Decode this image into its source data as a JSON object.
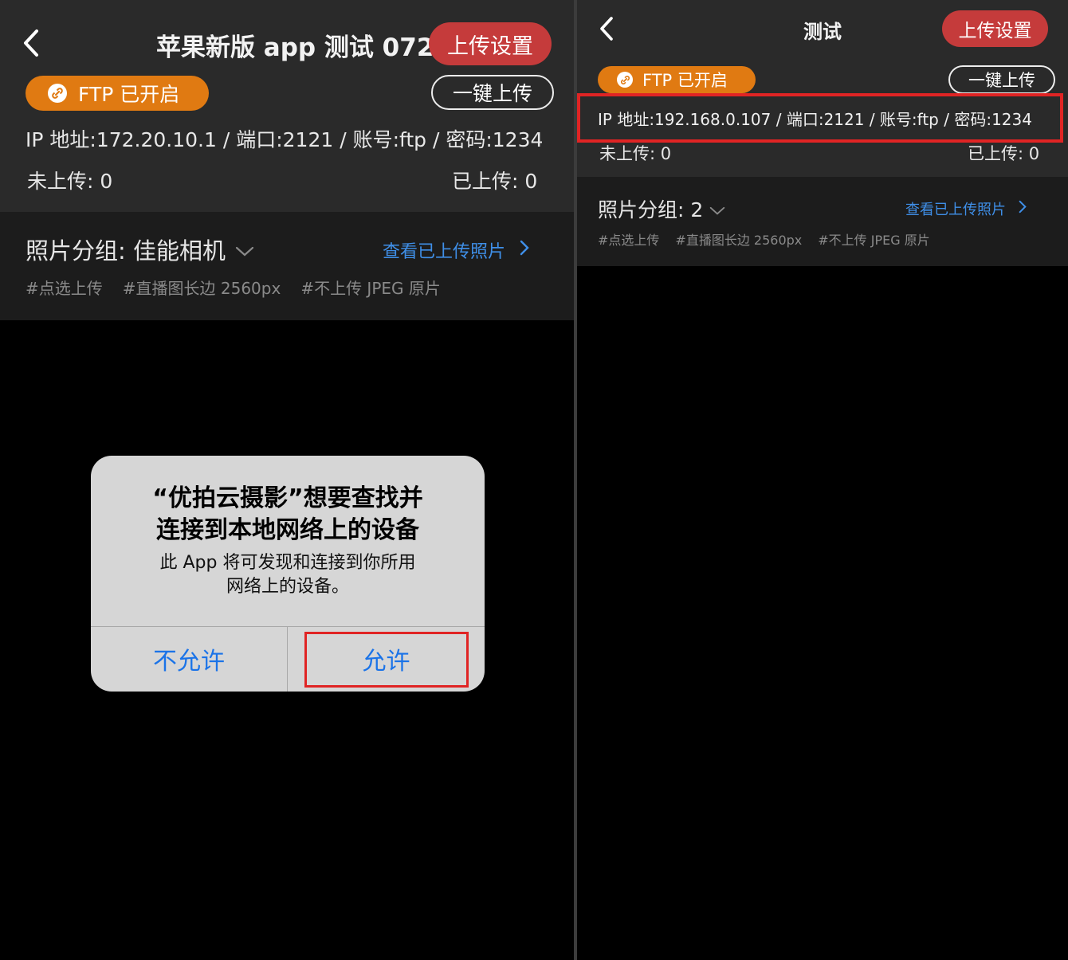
{
  "left_screen": {
    "title": "苹果新版 app 测试 0727",
    "upload_settings_label": "上传设置",
    "ftp_badge_label": "FTP 已开启",
    "one_click_upload_label": "一键上传",
    "connection_info": "IP 地址:172.20.10.1 / 端口:2121 / 账号:ftp / 密码:1234",
    "not_uploaded": "未上传:  0",
    "uploaded": "已上传:  0",
    "photo_group_label": "照片分组:  佳能相机",
    "view_uploaded_label": "查看已上传照片",
    "tags": [
      "#点选上传",
      "#直播图长边 2560px",
      "#不上传 JPEG 原片"
    ],
    "dialog": {
      "title_line1": "“优拍云摄影”想要查找并",
      "title_line2": "连接到本地网络上的设备",
      "message_line1": "此 App 将可发现和连接到你所用",
      "message_line2": "网络上的设备。",
      "deny_label": "不允许",
      "allow_label": "允许"
    }
  },
  "right_screen": {
    "title": "测试",
    "upload_settings_label": "上传设置",
    "ftp_badge_label": "FTP 已开启",
    "one_click_upload_label": "一键上传",
    "connection_info": "IP 地址:192.168.0.107 / 端口:2121 / 账号:ftp / 密码:1234",
    "not_uploaded": "未上传:  0",
    "uploaded": "已上传:  0",
    "photo_group_label": "照片分组:  2",
    "view_uploaded_label": "查看已上传照片",
    "tags": [
      "#点选上传",
      "#直播图长边 2560px",
      "#不上传 JPEG 原片"
    ]
  },
  "colors": {
    "accent_red": "#c53b3b",
    "ftp_orange": "#e07a12",
    "link_blue": "#3f8fe8",
    "highlight_red": "#e02424",
    "dialog_blue": "#1a73e8"
  }
}
